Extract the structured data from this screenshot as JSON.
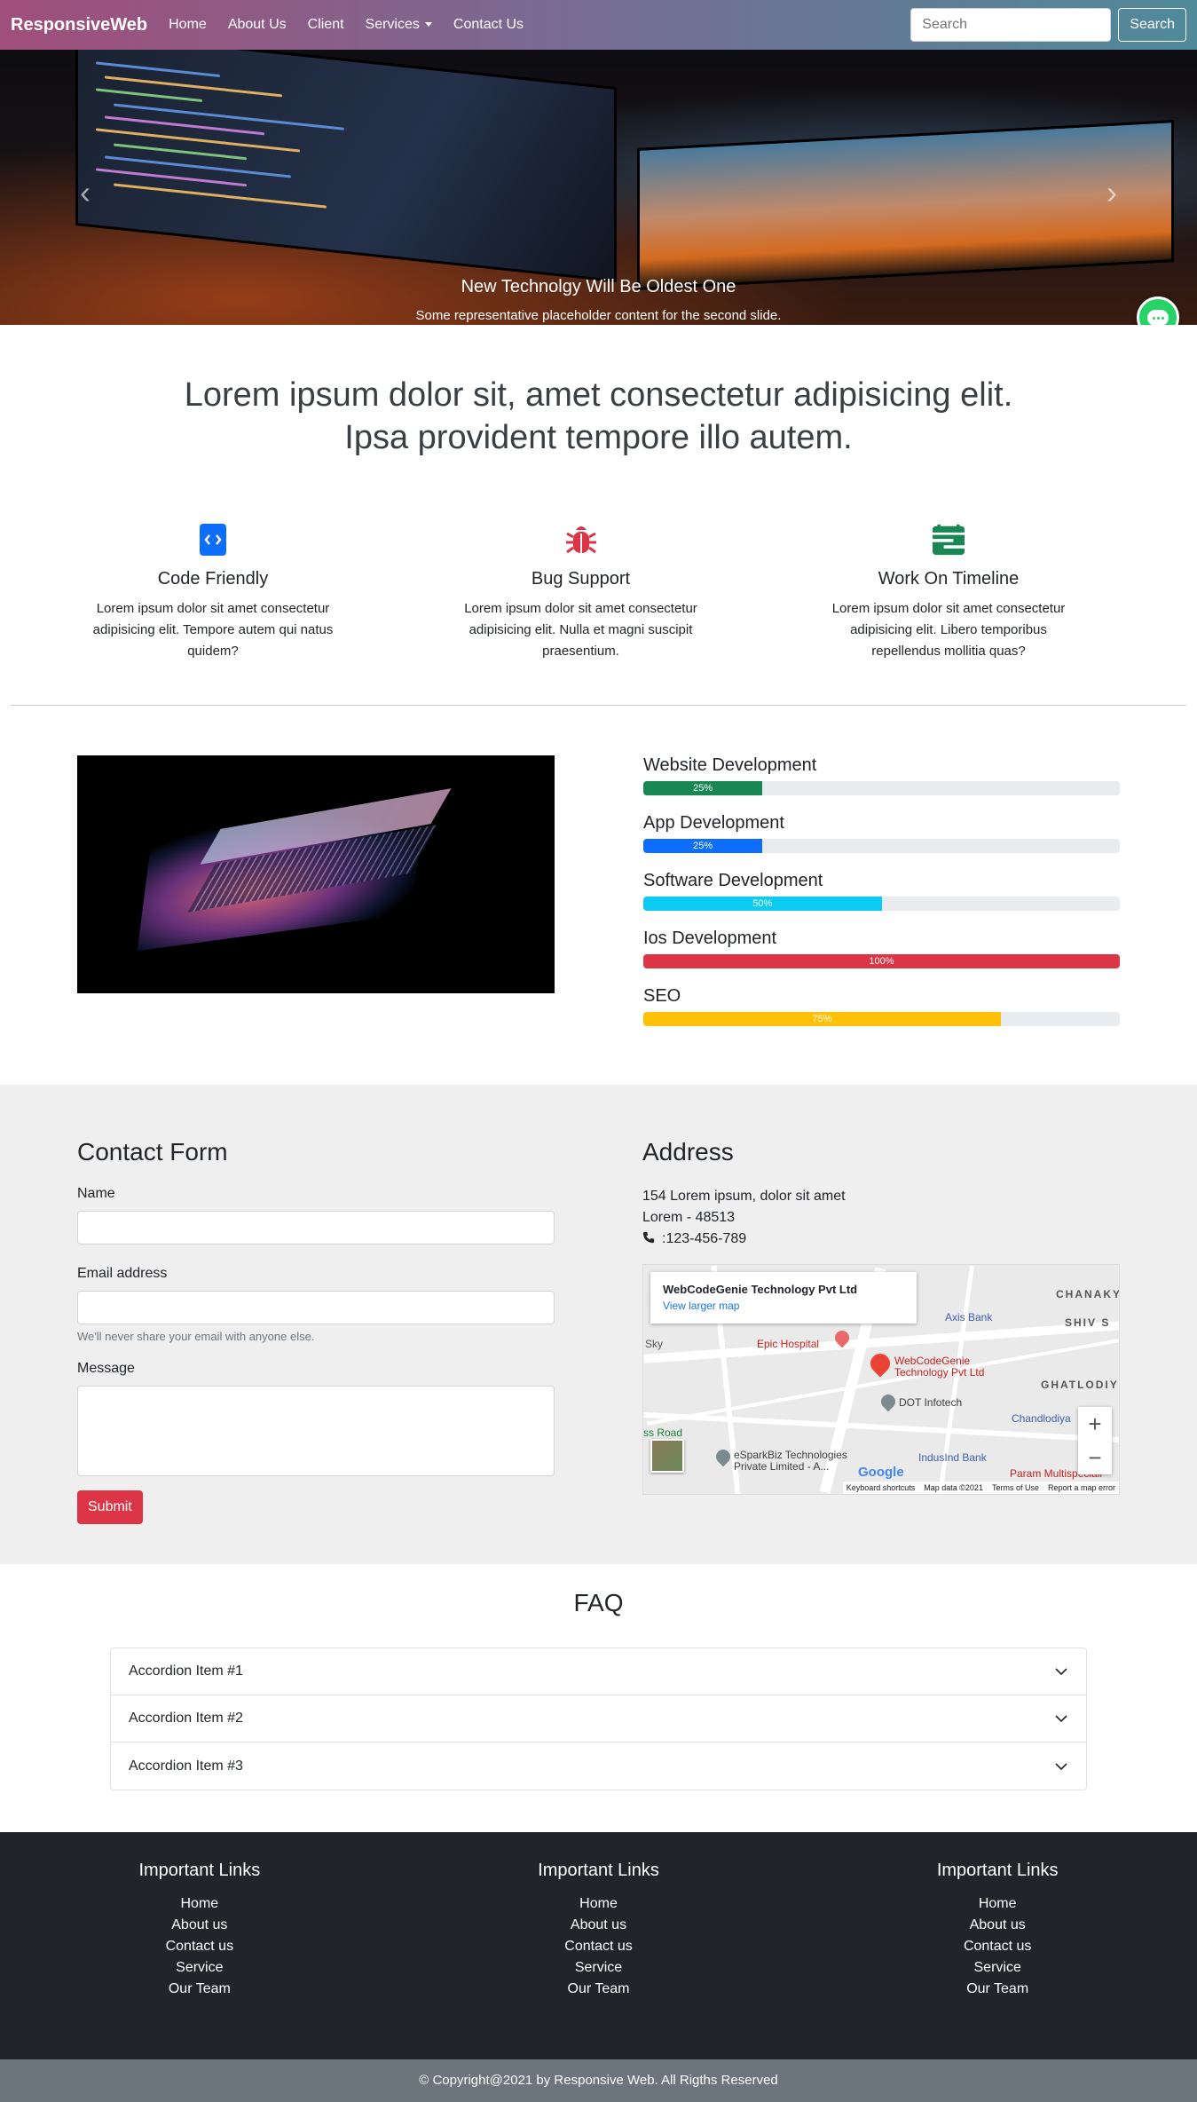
{
  "navbar": {
    "brand": "ResponsiveWeb",
    "links": [
      "Home",
      "About Us",
      "Client",
      "Services",
      "Contact Us"
    ],
    "search_placeholder": "Search",
    "search_button": "Search"
  },
  "hero": {
    "title": "New Technolgy Will Be Oldest One",
    "subtitle": "Some representative placeholder content for the second slide.",
    "active_slide": 2,
    "slides": 3
  },
  "lead": {
    "line1": "Lorem ipsum dolor sit, amet consectetur adipisicing elit.",
    "line2": "Ipsa provident tempore illo autem."
  },
  "features": [
    {
      "title": "Code Friendly",
      "text": "Lorem ipsum dolor sit amet consectetur adipisicing elit. Tempore autem qui natus quidem?",
      "icon": "code-icon",
      "color": "#0d6efd"
    },
    {
      "title": "Bug Support",
      "text": "Lorem ipsum dolor sit amet consectetur adipisicing elit. Nulla et magni suscipit praesentium.",
      "icon": "bug-icon",
      "color": "#dc3545"
    },
    {
      "title": "Work On Timeline",
      "text": "Lorem ipsum dolor sit amet consectetur adipisicing elit. Libero temporibus repellendus mollitia quas?",
      "icon": "calendar-icon",
      "color": "#198754"
    }
  ],
  "skills": [
    {
      "name": "Website Development",
      "percent": 25,
      "label": "25%",
      "color": "#198754"
    },
    {
      "name": "App Development",
      "percent": 25,
      "label": "25%",
      "color": "#0d6efd"
    },
    {
      "name": "Software Development",
      "percent": 50,
      "label": "50%",
      "color": "#0dcaf0"
    },
    {
      "name": "Ios Development",
      "percent": 100,
      "label": "100%",
      "color": "#dc3545"
    },
    {
      "name": "SEO",
      "percent": 75,
      "label": "75%",
      "color": "#ffc107"
    }
  ],
  "contact": {
    "title": "Contact Form",
    "name_label": "Name",
    "email_label": "Email address",
    "email_help": "We'll never share your email with anyone else.",
    "message_label": "Message",
    "submit": "Submit"
  },
  "address": {
    "title": "Address",
    "line1": "154 Lorem ipsum, dolor sit amet",
    "line2": "Lorem - 48513",
    "phone": ":123-456-789",
    "map": {
      "card_title": "WebCodeGenie Technology Pvt Ltd",
      "card_link": "View larger map",
      "pin_label_1": "WebCodeGenie",
      "pin_label_2": "Technology Pvt Ltd",
      "labels": [
        "Epic Hospital",
        "DOT Infotech",
        "Axis Bank",
        "IndusInd Bank",
        "eSparkBiz Technologies",
        "Private Limited - A...",
        "Chandlodiya",
        "CHANAKY",
        "SHIV S",
        "GHATLODIY",
        "Param Multispeciali",
        "Sky",
        "ss Road"
      ],
      "footer": [
        "Keyboard shortcuts",
        "Map data ©2021",
        "Terms of Use",
        "Report a map error"
      ],
      "brand": "Google"
    }
  },
  "faq": {
    "title": "FAQ",
    "items": [
      "Accordion Item #1",
      "Accordion Item #2",
      "Accordion Item #3"
    ]
  },
  "footer": {
    "columns": [
      {
        "title": "Important Links",
        "links": [
          "Home",
          "About us",
          "Contact us",
          "Service",
          "Our Team"
        ]
      },
      {
        "title": "Important Links",
        "links": [
          "Home",
          "About us",
          "Contact us",
          "Service",
          "Our Team"
        ]
      },
      {
        "title": "Important Links",
        "links": [
          "Home",
          "About us",
          "Contact us",
          "Service",
          "Our Team"
        ]
      }
    ],
    "copyright": "© Copyright@2021 by Responsive Web. All Rigths Reserved"
  }
}
